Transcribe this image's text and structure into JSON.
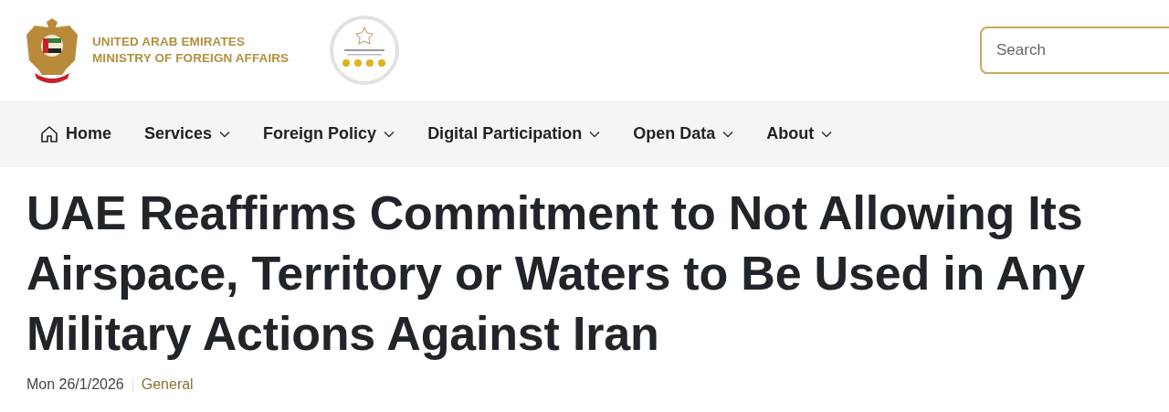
{
  "header": {
    "org_line_1": "UNITED ARAB EMIRATES",
    "org_line_2": "MINISTRY OF FOREIGN AFFAIRS",
    "search": {
      "placeholder": "Search"
    }
  },
  "nav": [
    {
      "label": "Home",
      "kind": "home"
    },
    {
      "label": "Services",
      "kind": "dropdown"
    },
    {
      "label": "Foreign Policy",
      "kind": "dropdown"
    },
    {
      "label": "Digital Participation",
      "kind": "dropdown"
    },
    {
      "label": "Open Data",
      "kind": "dropdown"
    },
    {
      "label": "About",
      "kind": "dropdown"
    }
  ],
  "article": {
    "title": "UAE Reaffirms Commitment to Not Allowing Its Airspace, Territory or Waters to Be Used in Any Military Actions Against Iran",
    "date": "Mon 26/1/2026",
    "category": "General"
  }
}
